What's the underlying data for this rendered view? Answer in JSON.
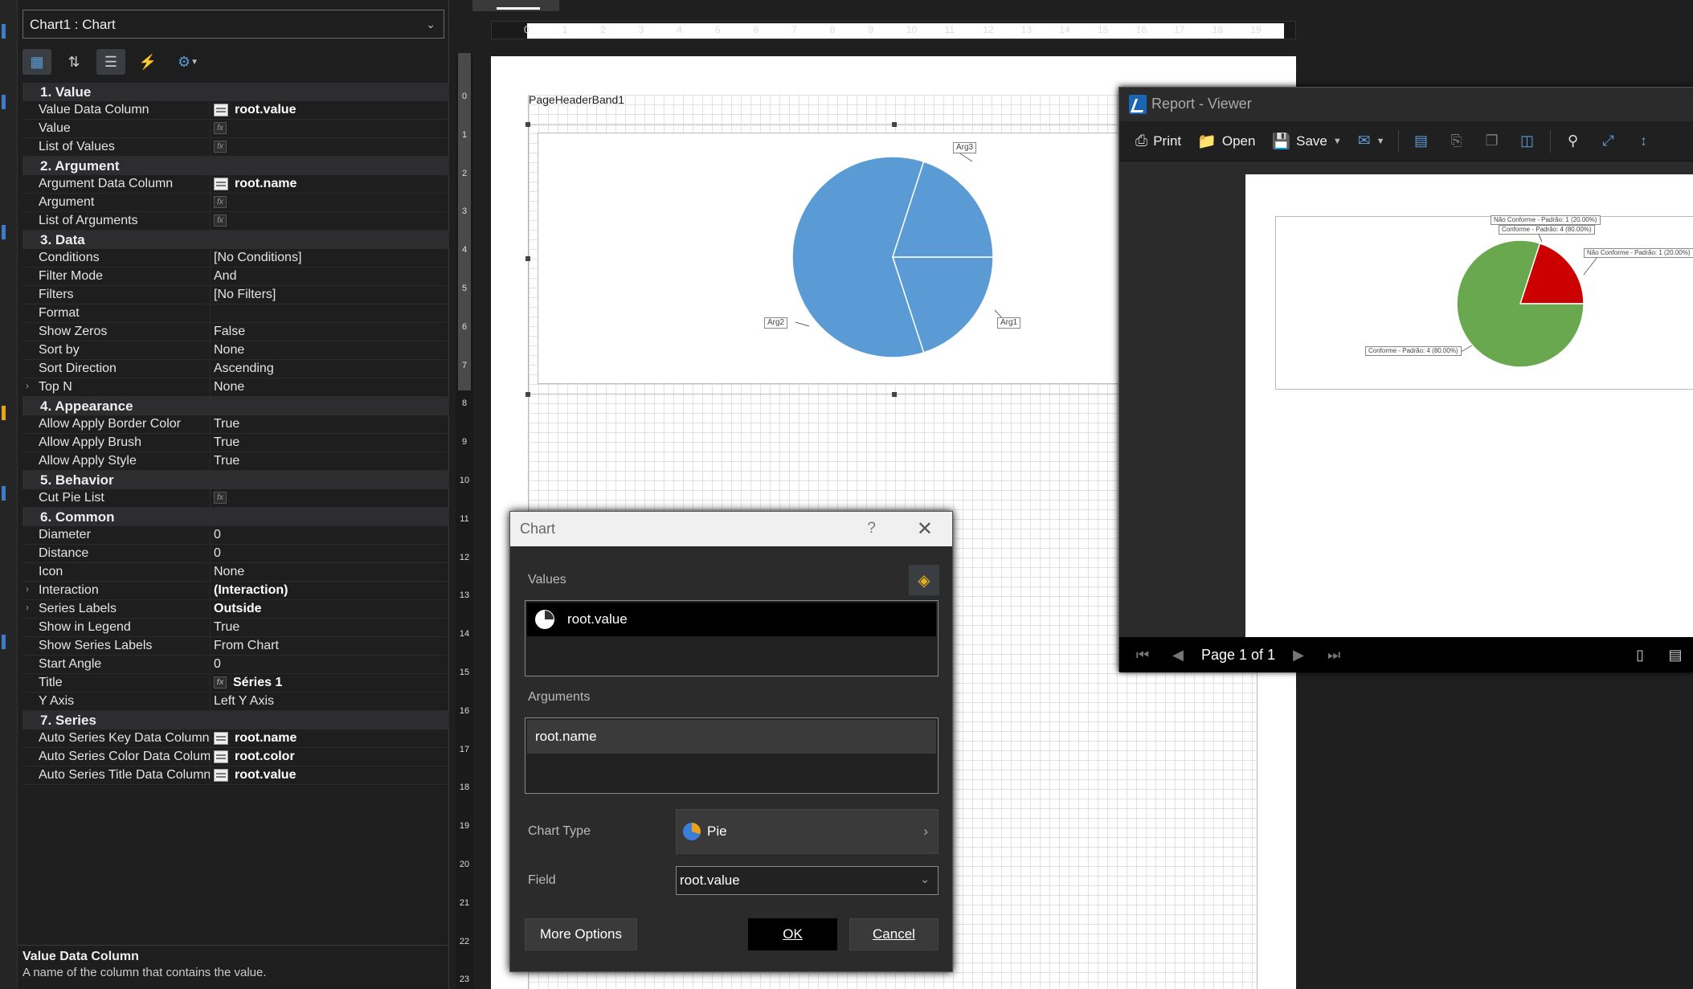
{
  "properties": {
    "object_combo": "Chart1 : Chart",
    "categories": [
      {
        "label": "1. Value",
        "rows": [
          {
            "name": "Value Data Column",
            "value": "root.value",
            "icon": "column",
            "bold": true
          },
          {
            "name": "Value",
            "value": "",
            "icon": "fx"
          },
          {
            "name": "List of Values",
            "value": "",
            "icon": "fx"
          }
        ]
      },
      {
        "label": "2. Argument",
        "rows": [
          {
            "name": "Argument Data Column",
            "value": "root.name",
            "icon": "column",
            "bold": true
          },
          {
            "name": "Argument",
            "value": "",
            "icon": "fx"
          },
          {
            "name": "List of Arguments",
            "value": "",
            "icon": "fx"
          }
        ]
      },
      {
        "label": "3. Data",
        "rows": [
          {
            "name": "Conditions",
            "value": "[No Conditions]"
          },
          {
            "name": "Filter Mode",
            "value": "And"
          },
          {
            "name": "Filters",
            "value": "[No Filters]"
          },
          {
            "name": "Format",
            "value": ""
          },
          {
            "name": "Show Zeros",
            "value": "False"
          },
          {
            "name": "Sort by",
            "value": "None"
          },
          {
            "name": "Sort Direction",
            "value": "Ascending"
          },
          {
            "name": "Top N",
            "value": "None",
            "expand": true
          }
        ]
      },
      {
        "label": "4. Appearance",
        "rows": [
          {
            "name": "Allow Apply Border Color",
            "value": "True"
          },
          {
            "name": "Allow Apply Brush",
            "value": "True"
          },
          {
            "name": "Allow Apply Style",
            "value": "True"
          }
        ]
      },
      {
        "label": "5. Behavior",
        "rows": [
          {
            "name": "Cut Pie List",
            "value": "",
            "icon": "fx"
          }
        ]
      },
      {
        "label": "6. Common",
        "rows": [
          {
            "name": "Diameter",
            "value": "0"
          },
          {
            "name": "Distance",
            "value": "0"
          },
          {
            "name": "Icon",
            "value": "None"
          },
          {
            "name": "Interaction",
            "value": "(Interaction)",
            "bold": true,
            "expand": true
          },
          {
            "name": "Series Labels",
            "value": "Outside",
            "bold": true,
            "expand": true
          },
          {
            "name": "Show in Legend",
            "value": "True"
          },
          {
            "name": "Show Series Labels",
            "value": "From Chart"
          },
          {
            "name": "Start Angle",
            "value": "0"
          },
          {
            "name": "Title",
            "value": "Séries 1",
            "icon": "fx",
            "bold": true
          },
          {
            "name": "Y Axis",
            "value": "Left Y Axis"
          }
        ]
      },
      {
        "label": "7. Series",
        "rows": [
          {
            "name": "Auto Series Key Data Column",
            "value": "root.name",
            "icon": "column",
            "bold": true
          },
          {
            "name": "Auto Series Color Data Column",
            "value": "root.color",
            "icon": "column",
            "bold": true
          },
          {
            "name": "Auto Series Title Data Column",
            "value": "root.value",
            "icon": "column",
            "bold": true
          }
        ]
      }
    ],
    "description_title": "Value Data Column",
    "description_text": "A name of the column that contains the value."
  },
  "designer": {
    "band_label": "PageHeaderBand1",
    "h_ruler": [
      "0",
      "1",
      "2",
      "3",
      "4",
      "5",
      "6",
      "7",
      "8",
      "9",
      "10",
      "11",
      "12",
      "13",
      "14",
      "15",
      "16",
      "17",
      "18",
      "19"
    ],
    "v_ruler": [
      "0",
      "1",
      "2",
      "3",
      "4",
      "5",
      "6",
      "7",
      "8",
      "9",
      "10",
      "11",
      "12",
      "13",
      "14",
      "15",
      "16",
      "17",
      "18",
      "19",
      "20",
      "21",
      "22",
      "23"
    ],
    "chart_labels": {
      "arg1": "Arg1",
      "arg2": "Arg2",
      "arg3": "Arg3"
    },
    "pie_color": "#5b9bd5"
  },
  "viewer": {
    "title": "Report - Viewer",
    "print": "Print",
    "open": "Open",
    "save": "Save",
    "status_page": "Page 1 of 1",
    "labels": {
      "nc_top": "Não Conforme - Padrão: 1 (20.00%)",
      "c_top": "Conforme - Padrão: 4 (80.00%)",
      "nc_right": "Não Conforme - Padrão: 1 (20.00%)",
      "c_left": "Conforme - Padrão: 4 (80.00%)"
    },
    "colors": {
      "conforme": "#6aa84f",
      "nao_conforme": "#cc0000"
    }
  },
  "dialog": {
    "title": "Chart",
    "help": "?",
    "values_label": "Values",
    "values_item": "root.value",
    "arguments_label": "Arguments",
    "arguments_item": "root.name",
    "chart_type_label": "Chart Type",
    "chart_type_value": "Pie",
    "field_label": "Field",
    "field_value": "root.value",
    "more_options": "More Options",
    "ok": "OK",
    "cancel": "Cancel"
  },
  "chart_data": [
    {
      "type": "pie",
      "categories": [
        "Arg1",
        "Arg2",
        "Arg3"
      ],
      "values": [
        1,
        3,
        1
      ],
      "title": ""
    },
    {
      "type": "pie",
      "categories": [
        "Conforme - Padrão",
        "Não Conforme - Padrão"
      ],
      "values": [
        4,
        1
      ],
      "percentages": [
        80,
        20
      ],
      "title": ""
    }
  ]
}
